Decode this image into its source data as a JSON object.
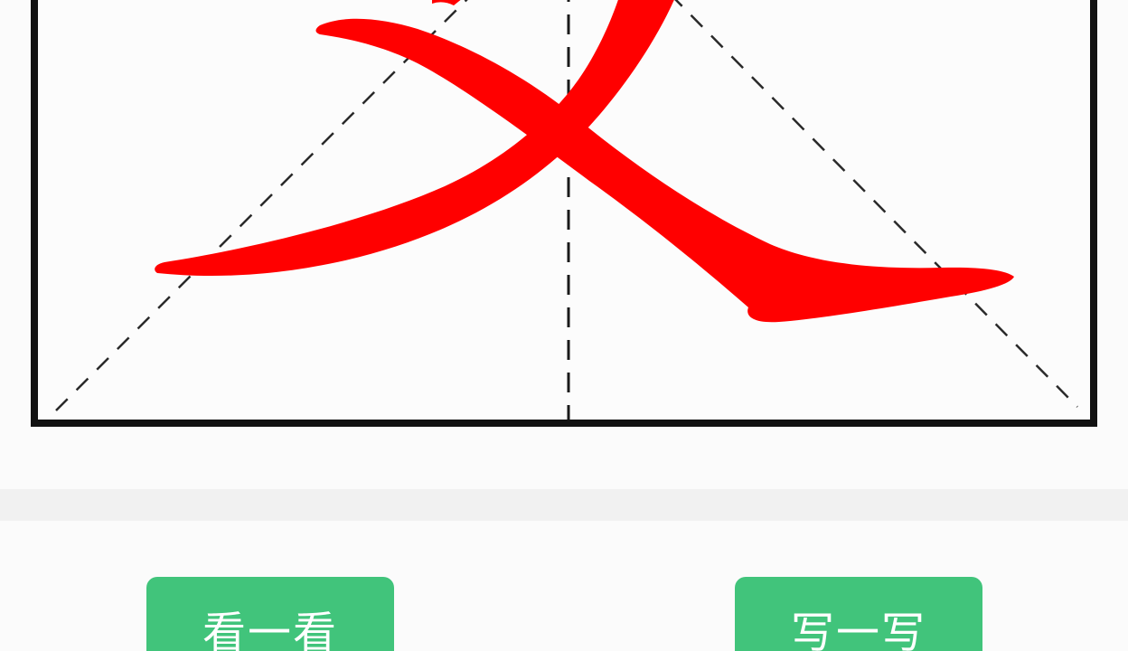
{
  "practice": {
    "character": "文",
    "stroke_color": "#ff0000",
    "grid_line_color": "#1a1a1a",
    "border_color": "#121212"
  },
  "buttons": {
    "look_label": "看一看",
    "write_label": "写一写",
    "color": "#41c47b"
  }
}
